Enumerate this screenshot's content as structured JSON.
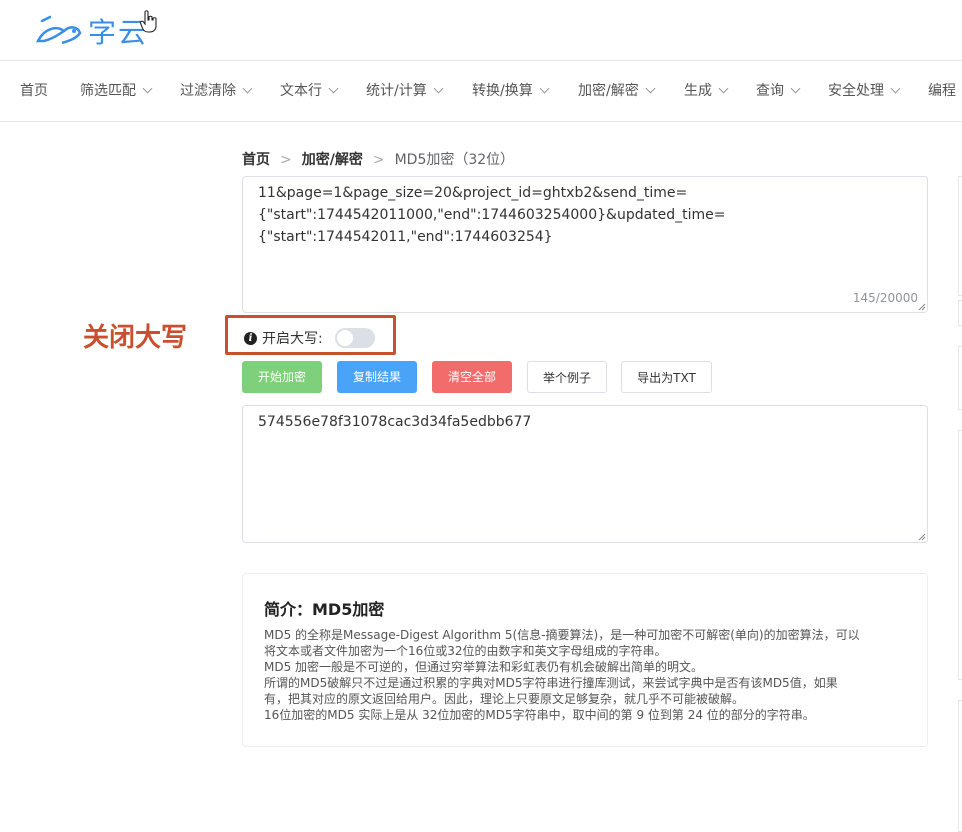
{
  "logo": {
    "text": "字云"
  },
  "nav": {
    "items": [
      {
        "label": "首页",
        "has_dropdown": false
      },
      {
        "label": "筛选匹配",
        "has_dropdown": true
      },
      {
        "label": "过滤清除",
        "has_dropdown": true
      },
      {
        "label": "文本行",
        "has_dropdown": true
      },
      {
        "label": "统计/计算",
        "has_dropdown": true
      },
      {
        "label": "转换/换算",
        "has_dropdown": true
      },
      {
        "label": "加密/解密",
        "has_dropdown": true
      },
      {
        "label": "生成",
        "has_dropdown": true
      },
      {
        "label": "查询",
        "has_dropdown": true
      },
      {
        "label": "安全处理",
        "has_dropdown": true
      },
      {
        "label": "编程",
        "has_dropdown": false
      }
    ]
  },
  "breadcrumb": {
    "home": "首页",
    "category": "加密/解密",
    "current": "MD5加密（32位）"
  },
  "input": {
    "lines": [
      "11&page=1&page_size=20&project_id=ghtxb2&send_time=",
      "{\"start\":1744542011000,\"end\":1744603254000}&updated_time=",
      "{\"start\":1744542011,\"end\":1744603254}"
    ],
    "counter": "145/20000"
  },
  "annotation": {
    "label": "关闭大写"
  },
  "uppercase_toggle": {
    "label": "开启大写:",
    "on": false
  },
  "buttons": {
    "encrypt": "开始加密",
    "copy": "复制结果",
    "clear": "清空全部",
    "example": "举个例子",
    "export": "导出为TXT"
  },
  "output": {
    "value": "574556e78f31078cac3d34fa5edbb677"
  },
  "intro": {
    "title": "简介：MD5加密",
    "lines": [
      "MD5 的全称是Message-Digest Algorithm 5(信息-摘要算法)，是一种可加密不可解密(单向)的加密算法，可以",
      "将文本或者文件加密为一个16位或32位的由数字和英文字母组成的字符串。",
      "MD5 加密一般是不可逆的，但通过穷举算法和彩虹表仍有机会破解出简单的明文。",
      "所谓的MD5破解只不过是通过积累的字典对MD5字符串进行撞库测试，来尝试字典中是否有该MD5值，如果",
      "有，把其对应的原文返回给用户。因此，理论上只要原文足够复杂，就几乎不可能被破解。",
      "16位加密的MD5 实际上是从 32位加密的MD5字符串中，取中间的第 9 位到第 24 位的部分的字符串。"
    ]
  },
  "colors": {
    "accent": "#3a8ee6",
    "annotation": "#c8502f",
    "btn_green": "#7ed07a",
    "btn_blue": "#4aa3f7",
    "btn_red": "#f26c6c"
  }
}
